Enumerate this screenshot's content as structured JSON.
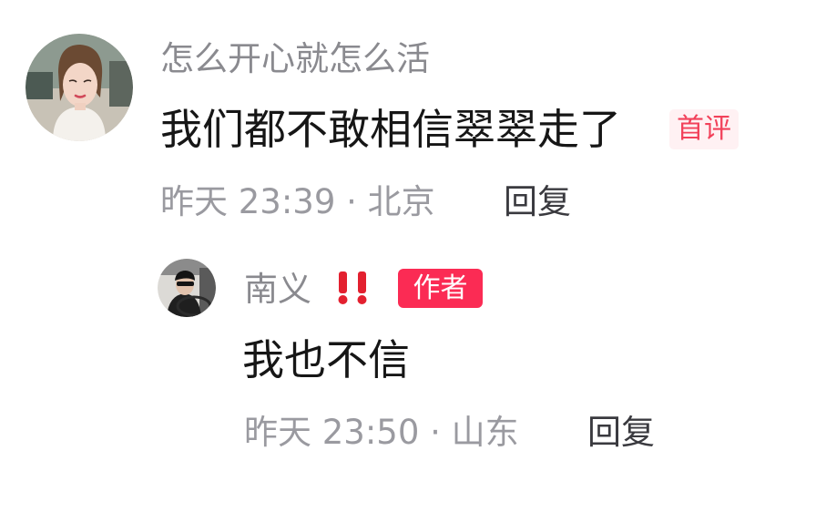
{
  "comment": {
    "username": "怎么开心就怎么活",
    "text": "我们都不敢相信翠翠走了",
    "badge": "首评",
    "timestamp": "昨天 23:39 · 北京",
    "reply_label": "回复"
  },
  "reply": {
    "username": "南义",
    "emoji": "‼️",
    "author_badge": "作者",
    "text": "我也不信",
    "timestamp": "昨天 23:50 · 山东",
    "reply_label": "回复"
  },
  "colors": {
    "username": "#8a8a8f",
    "text": "#161616",
    "meta": "#9a9aa0",
    "badge_first": "#f2415a",
    "badge_author": "#fb2b54"
  },
  "icons": {
    "comment_avatar": "user-avatar-woman",
    "reply_avatar": "user-avatar-driver",
    "emoji": "double-exclamation-icon"
  }
}
